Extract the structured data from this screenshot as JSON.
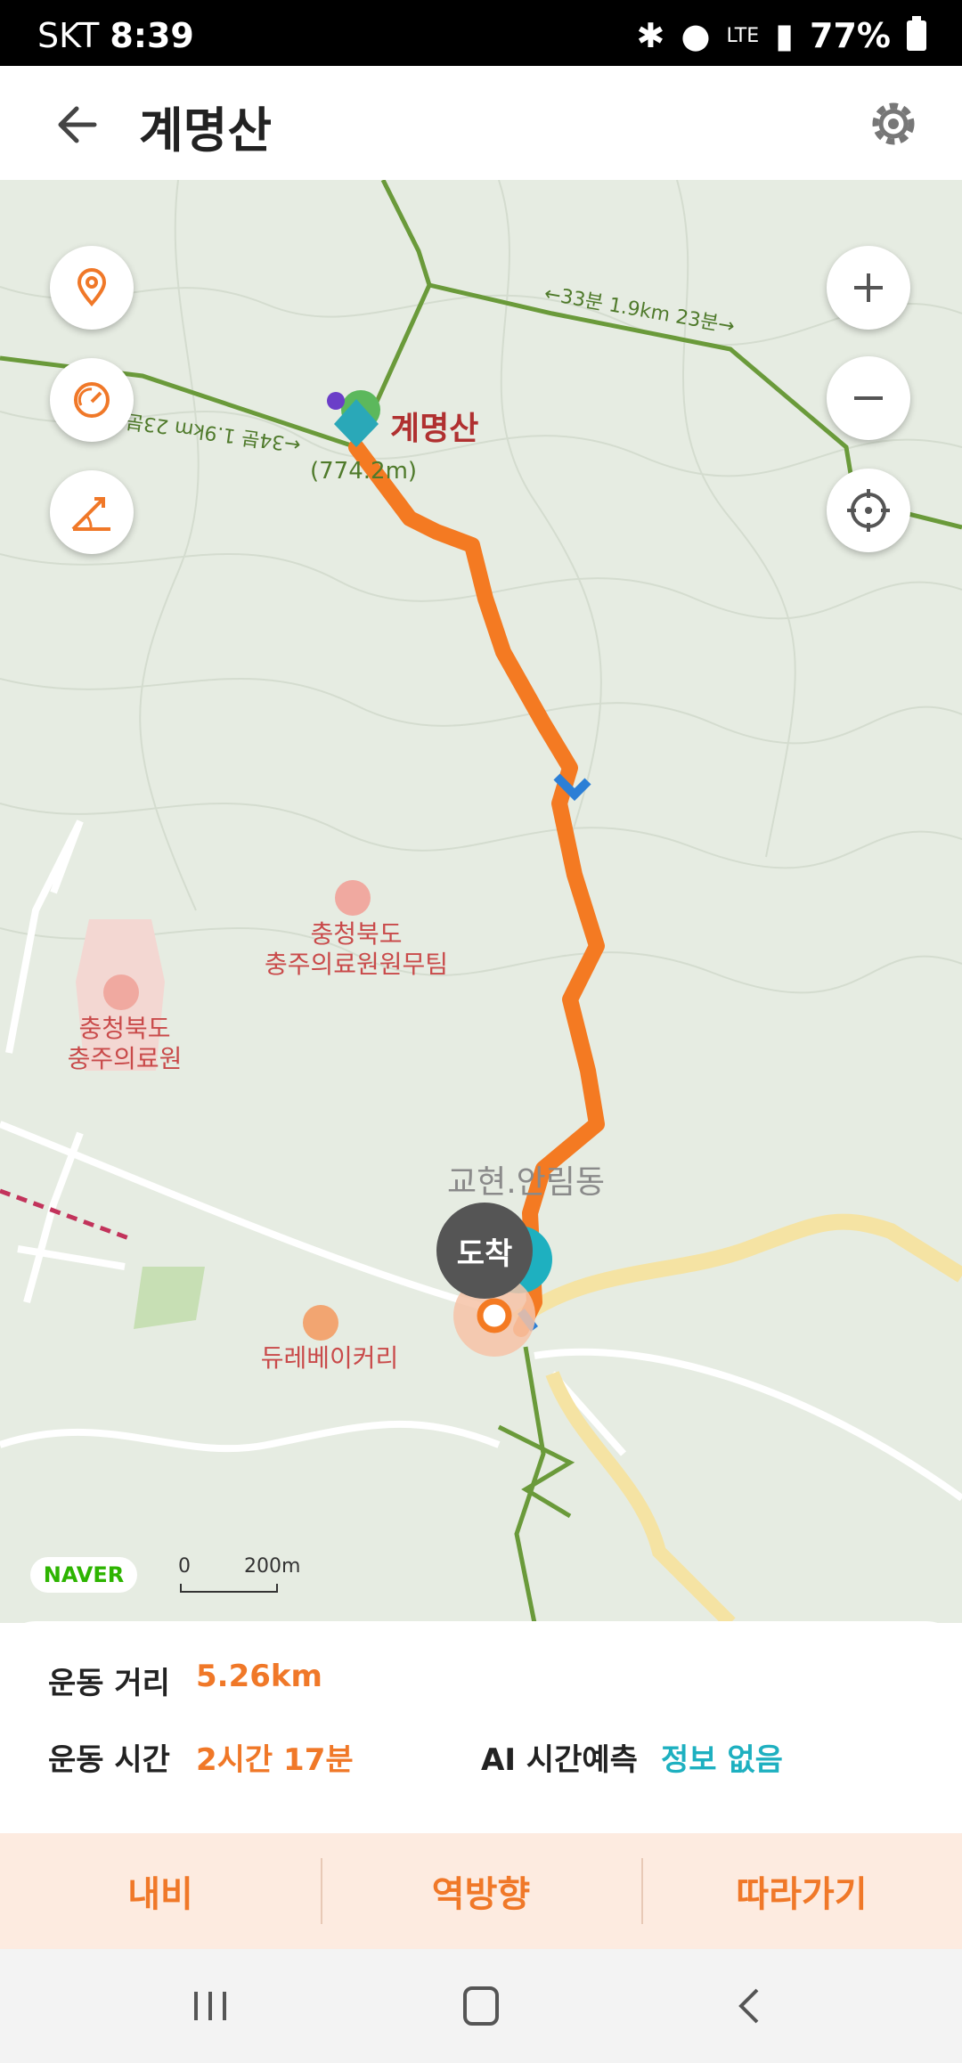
{
  "status_bar": {
    "carrier": "SKT",
    "time": "8:39",
    "network": "LTE",
    "battery": "77%"
  },
  "header": {
    "title": "계명산",
    "back_icon": "arrow-left-icon",
    "settings_icon": "gear-icon"
  },
  "map": {
    "peak_label": "계명산",
    "peak_elevation": "(774.2m)",
    "trail_label_right": "←33분 1.9km 23분→",
    "trail_label_left": "←34분 1.9km 23분",
    "poi_1": {
      "line1": "충청북도",
      "line2": "충주의료원원무팀"
    },
    "poi_2": {
      "line1": "충청북도",
      "line2": "충주의료원"
    },
    "restaurant": "듀레베이커리",
    "district": "교현.안림동",
    "arrival": "도착",
    "naver": "NAVER",
    "scale_zero": "0",
    "scale_distance": "200m",
    "route_color": "#f47a22",
    "trail_color": "#6a9a3a"
  },
  "map_controls": {
    "left": [
      "location-pin-icon",
      "speedometer-icon",
      "slope-icon"
    ],
    "right": [
      "zoom-in-icon",
      "zoom-out-icon",
      "my-location-icon"
    ]
  },
  "stats": {
    "distance_label": "운동 거리",
    "distance_value": "5.26km",
    "time_label": "운동 시간",
    "time_value": "2시간 17분",
    "ai_label": "AI 시간예측",
    "ai_value": "정보 없음",
    "accent_orange": "#f07828",
    "accent_teal": "#1eb0c0"
  },
  "actions": {
    "navi": "내비",
    "reverse": "역방향",
    "follow": "따라가기"
  }
}
